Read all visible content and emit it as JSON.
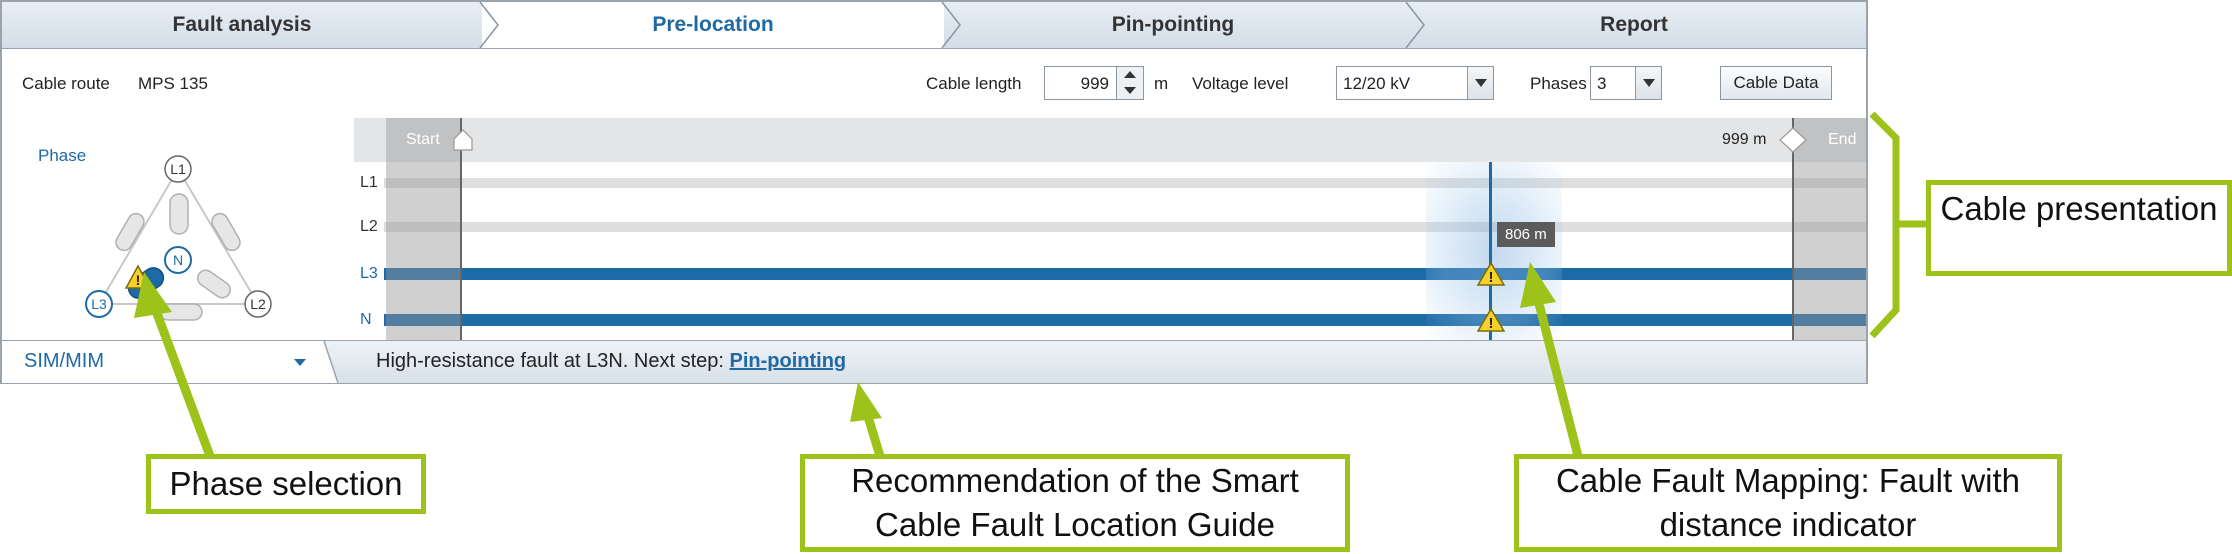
{
  "steps": [
    "Fault analysis",
    "Pre-location",
    "Pin-pointing",
    "Report"
  ],
  "toolbar": {
    "cable_route_label": "Cable route",
    "cable_route_value": "MPS 135",
    "cable_length_label": "Cable length",
    "cable_length_value": "999",
    "cable_length_unit": "m",
    "voltage_label": "Voltage level",
    "voltage_value": "12/20 kV",
    "phases_label": "Phases",
    "phases_value": "3",
    "cable_data_button": "Cable Data"
  },
  "phase_panel": {
    "title": "Phase",
    "nodes": [
      "L1",
      "L2",
      "L3",
      "N"
    ]
  },
  "chart": {
    "start_label": "Start",
    "end_label": "End",
    "end_distance": "999 m",
    "rows": [
      "L1",
      "L2",
      "L3",
      "N"
    ],
    "fault_distance": "806 m",
    "fault_position_fraction": 0.806,
    "highlighted_rows": [
      "L3",
      "N"
    ]
  },
  "status": {
    "mode": "SIM/MIM",
    "message": "High-resistance fault at L3N. Next step: ",
    "next_step_link": "Pin-pointing"
  },
  "callouts": {
    "cable_presentation": "Cable presentation",
    "phase_selection": "Phase selection",
    "recommendation": "Recommendation of the Smart Cable Fault Location Guide",
    "fault_mapping": "Cable Fault Mapping: Fault with distance indicator"
  },
  "colors": {
    "accent_blue": "#1f6aa5",
    "callout_green": "#9dc31a",
    "warning_yellow": "#f5d12a"
  }
}
